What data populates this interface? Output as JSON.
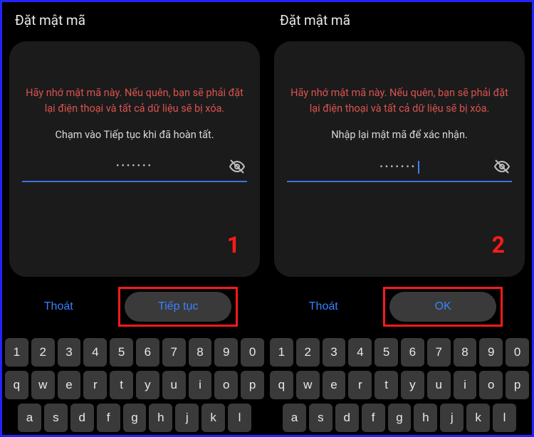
{
  "left": {
    "title": "Đặt mật mã",
    "warning": "Hãy nhớ mật mã này. Nếu quên, bạn sẽ phải đặt lại điện thoại và tất cả dữ liệu sẽ bị xóa.",
    "hint": "Chạm vào Tiếp tục khi đã hoàn tất.",
    "password_mask": "•••••••",
    "step": "1",
    "cancel": "Thoát",
    "primary": "Tiếp tục"
  },
  "right": {
    "title": "Đặt mật mã",
    "warning": "Hãy nhớ mật mã này. Nếu quên, bạn sẽ phải đặt lại điện thoại và tất cả dữ liệu sẽ bị xóa.",
    "hint": "Nhập lại mật mã để xác nhận.",
    "password_mask": "•••••••",
    "step": "2",
    "cancel": "Thoát",
    "primary": "OK"
  },
  "keyboard": {
    "row1": [
      "1",
      "2",
      "3",
      "4",
      "5",
      "6",
      "7",
      "8",
      "9",
      "0"
    ],
    "row2": [
      "q",
      "w",
      "e",
      "r",
      "t",
      "y",
      "u",
      "i",
      "o",
      "p"
    ],
    "row3": [
      "a",
      "s",
      "d",
      "f",
      "g",
      "h",
      "j",
      "k",
      "l"
    ]
  }
}
